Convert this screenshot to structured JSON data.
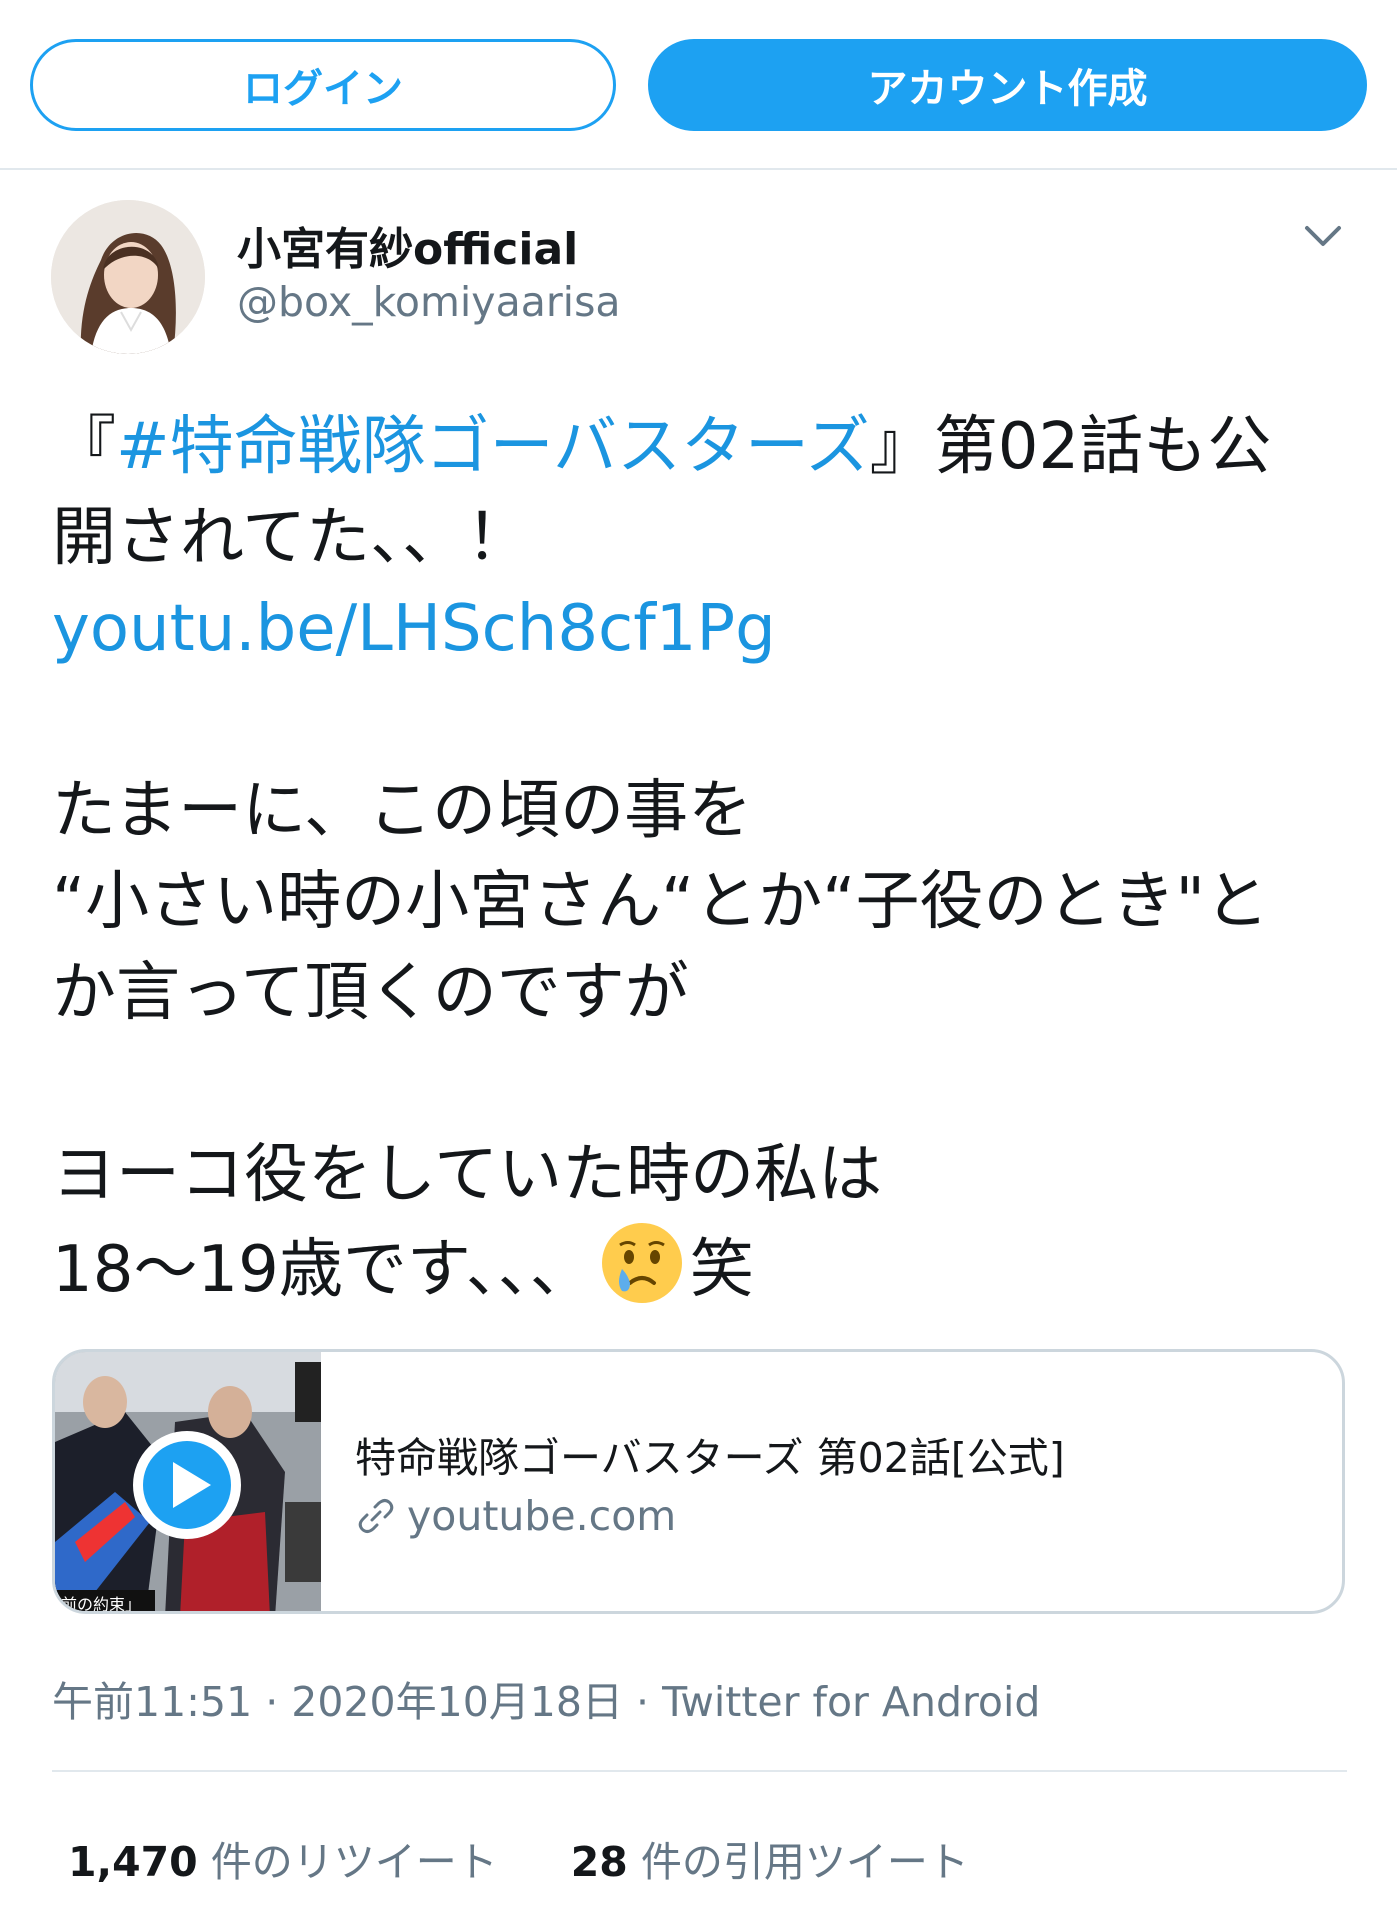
{
  "topbar": {
    "login_label": "ログイン",
    "signup_label": "アカウント作成"
  },
  "colors": {
    "accent": "#1da1f2",
    "link": "#1b95e0",
    "secondary_text": "#657786",
    "border": "#e1e8ed"
  },
  "user": {
    "display_name": "小宮有紗official",
    "handle": "@box_komiyaarisa"
  },
  "tweet": {
    "line1_open": "『",
    "line1_hashtag": "#特命戦隊ゴーバスターズ",
    "line1_rest": "』第02話も公",
    "line2": "開されてた、、！",
    "line3_link": "youtu.be/LHSch8cf1Pg",
    "line5": "たまーに、この頃の事を",
    "line6": "“小さい時の小宮さん“とか“子役のとき\"と",
    "line7": "か言って頂くのですが",
    "line9": "ヨーコ役をしていた時の私は",
    "line10_pre": "18〜19歳です、、、",
    "line10_emoji": "crying-face-emoji",
    "line10_post": "笑"
  },
  "card": {
    "title": "特命戦隊ゴーバスターズ 第02話[公式]",
    "domain": "youtube.com",
    "thumb_caption": "前の約束」",
    "icons": [
      "play-icon",
      "link-icon"
    ]
  },
  "meta": {
    "time": "午前11:51",
    "sep1": " · ",
    "date": "2020年10月18日",
    "sep2": " · ",
    "source": "Twitter for Android"
  },
  "stats": {
    "retweets_count": "1,470",
    "retweets_label": " 件のリツイート",
    "quotes_count": "28",
    "quotes_label": " 件の引用ツイート"
  }
}
